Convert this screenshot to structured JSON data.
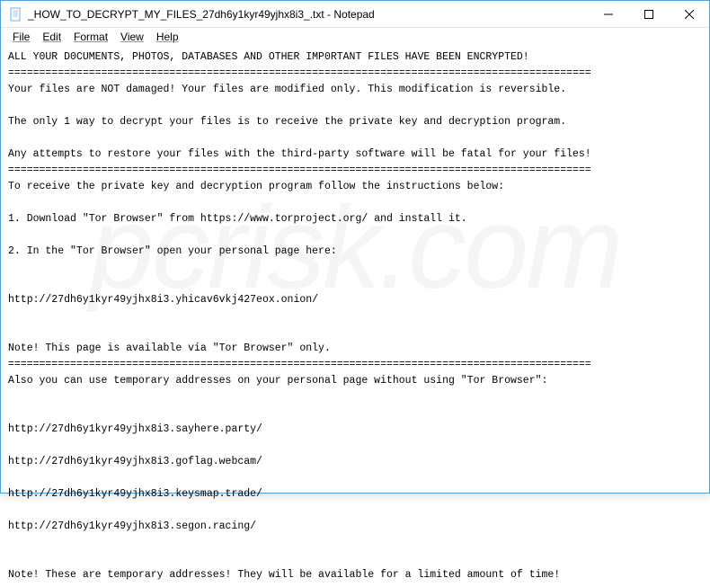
{
  "title_bar": {
    "filename": "_HOW_TO_DECRYPT_MY_FILES_27dh6y1kyr49yjhx8i3_.txt - Notepad"
  },
  "menu": {
    "file": "File",
    "edit": "Edit",
    "format": "Format",
    "view": "View",
    "help": "Help"
  },
  "content": {
    "line1": "ALL Y0UR D0CUMENTS, PHOTOS, DATABASES AND OTHER IMP0RTANT FILES HAVE BEEN ENCRYPTED!",
    "divider": "==============================================================================================",
    "line2": "Your files are NOT damaged! Your files are modified only. This modification is reversible.",
    "line3": "The only 1 way to decrypt your files is to receive the private key and decryption program.",
    "line4": "Any attempts to restore your files with the third-party software will be fatal for your files!",
    "line5": "To receive the private key and decryption program follow the instructions below:",
    "step1": "1. Download \"Tor Browser\" from https://www.torproject.org/ and install it.",
    "step2": "2. In the \"Tor Browser\" open your personal page here:",
    "url1": "http://27dh6y1kyr49yjhx8i3.yhicav6vkj427eox.onion/",
    "note1": "Note! This page is available via \"Tor Browser\" only.",
    "line6": "Also you can use temporary addresses on your personal page without using \"Tor Browser\":",
    "url2": "http://27dh6y1kyr49yjhx8i3.sayhere.party/",
    "url3": "http://27dh6y1kyr49yjhx8i3.goflag.webcam/",
    "url4": "http://27dh6y1kyr49yjhx8i3.keysmap.trade/",
    "url5": "http://27dh6y1kyr49yjhx8i3.segon.racing/",
    "note2": "Note! These are temporary addresses! They will be available for a limited amount of time!"
  }
}
